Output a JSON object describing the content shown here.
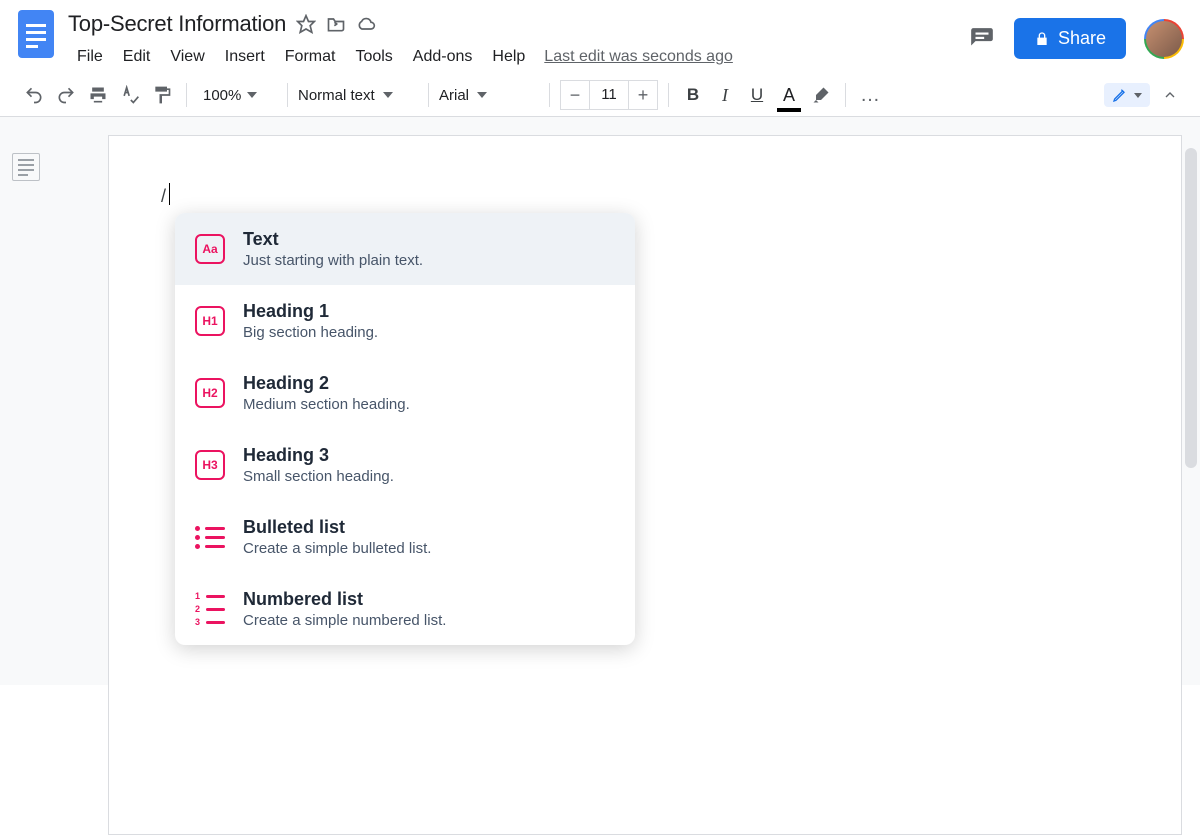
{
  "header": {
    "title": "Top-Secret Information",
    "menus": {
      "file": "File",
      "edit": "Edit",
      "view": "View",
      "insert": "Insert",
      "format": "Format",
      "tools": "Tools",
      "addons": "Add-ons",
      "help": "Help"
    },
    "last_edit": "Last edit was seconds ago",
    "share_label": "Share"
  },
  "toolbar": {
    "zoom": "100%",
    "style": "Normal text",
    "font": "Arial",
    "size": "11",
    "bold": "B",
    "italic": "I",
    "underline": "U",
    "textcolor": "A",
    "more": "…"
  },
  "doc": {
    "slash": "/"
  },
  "popup": {
    "items": [
      {
        "icon_label": "Aa",
        "title": "Text",
        "desc": "Just starting with plain text."
      },
      {
        "icon_label": "H1",
        "title": "Heading 1",
        "desc": "Big section heading."
      },
      {
        "icon_label": "H2",
        "title": "Heading 2",
        "desc": "Medium section heading."
      },
      {
        "icon_label": "H3",
        "title": "Heading 3",
        "desc": "Small section heading."
      },
      {
        "icon_label": "",
        "title": "Bulleted list",
        "desc": "Create a simple bulleted list."
      },
      {
        "icon_label": "",
        "title": "Numbered list",
        "desc": "Create a simple numbered list."
      }
    ]
  }
}
